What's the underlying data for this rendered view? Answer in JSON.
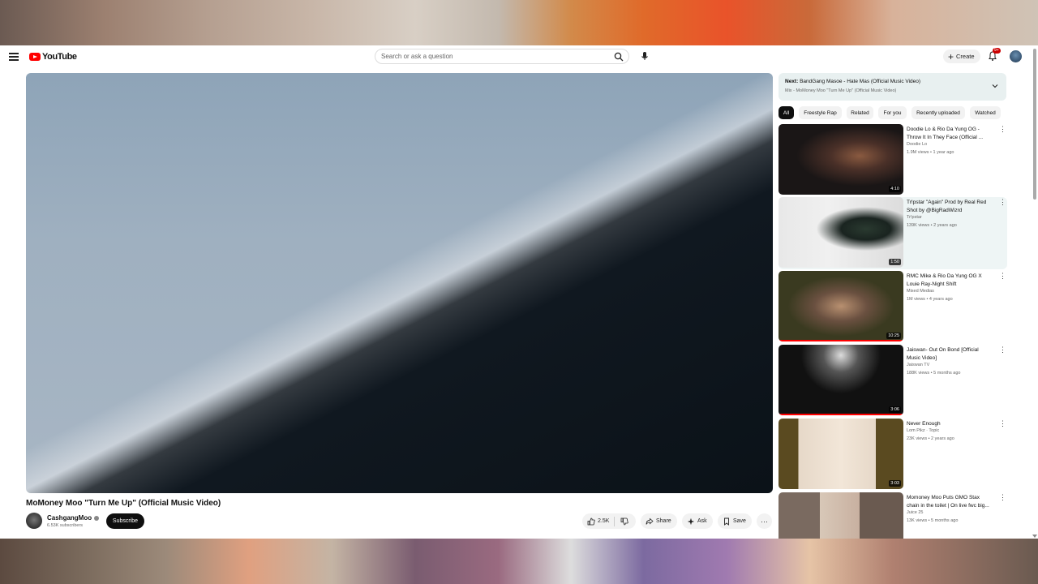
{
  "header": {
    "logo_text": "YouTube",
    "search_placeholder": "Search or ask a question",
    "create_label": "Create",
    "notification_badge": "9+"
  },
  "video": {
    "title": "MoMoney Moo \"Turn Me Up\" (Official Music Video)",
    "channel": "CashgangMoo",
    "subscribers": "6.53K subscribers",
    "subscribe_label": "Subscribe",
    "likes": "2.5K",
    "share_label": "Share",
    "ask_label": "Ask",
    "save_label": "Save"
  },
  "up_next": {
    "prefix": "Next:",
    "title": "BandGang Masoe - Hate Mas (Official Music Video)",
    "playlist": "Mix - MoMoney Moo \"Turn Me Up\" (Official Music Video)"
  },
  "chips": [
    "All",
    "Freestyle Rap",
    "Related",
    "For you",
    "Recently uploaded",
    "Watched"
  ],
  "recommendations": [
    {
      "title": "Doodie Lo & Rio Da Yung OG - Throw It In They Face (Official ...",
      "channel": "Doodie Lo",
      "meta": "1.9M views • 1 year ago",
      "duration": "4:10"
    },
    {
      "title": "Tr!pstar \"Again\" Prod by Real Red Shot by @BigRadWizrd",
      "channel": "Tr!pstar",
      "meta": "139K views • 2 years ago",
      "duration": "1:50"
    },
    {
      "title": "RMC Mike & Rio Da Yung OG X Louie Ray-Night Shift",
      "channel": "Mixed Medias",
      "meta": "1M views • 4 years ago",
      "duration": "10:25"
    },
    {
      "title": "Jaiswan- Out On Bond [Official Music Video]",
      "channel": "Jaiswan TV",
      "meta": "188K views • 5 months ago",
      "duration": "3:06"
    },
    {
      "title": "Never Enough",
      "channel": "Lom Pikz · Topic",
      "meta": "23K views • 2 years ago",
      "duration": "3:03"
    },
    {
      "title": "Momoney Moo Puts GMO Stax chain in the toilet | On live fwc big...",
      "channel": "Juice 25",
      "meta": "13K views • 5 months ago",
      "duration": ""
    }
  ],
  "colors": {
    "accent": "#ff0000",
    "subscribe_bg": "#0f0f0f",
    "chip_active": "#0f0f0f",
    "highlight": "#eef5f5"
  }
}
